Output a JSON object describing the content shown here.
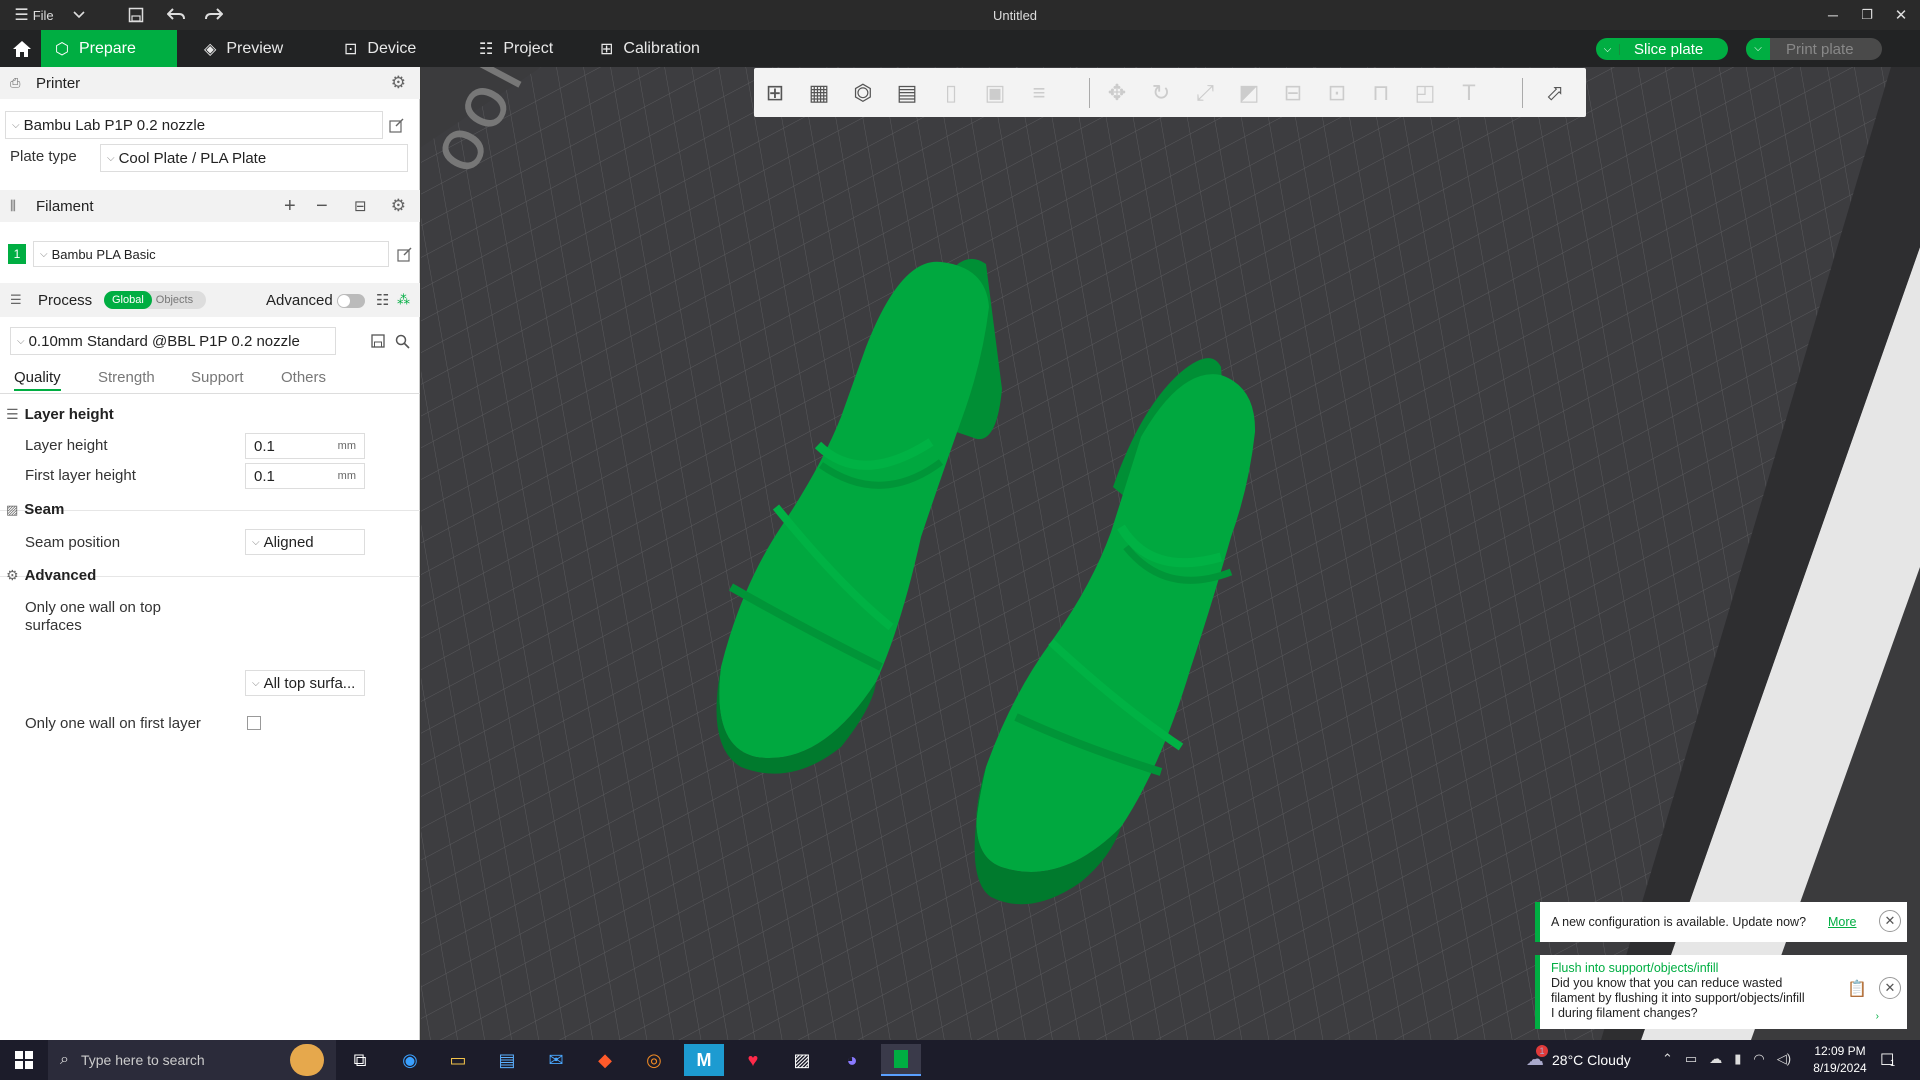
{
  "window": {
    "title": "Untitled",
    "file_menu": "File"
  },
  "nav": {
    "tabs": [
      {
        "label": "Prepare",
        "active": true
      },
      {
        "label": "Preview"
      },
      {
        "label": "Device"
      },
      {
        "label": "Project"
      },
      {
        "label": "Calibration"
      }
    ],
    "slice_button": "Slice plate",
    "print_button": "Print plate"
  },
  "printer": {
    "section_title": "Printer",
    "selected": "Bambu Lab P1P 0.2 nozzle",
    "plate_type_label": "Plate type",
    "plate_type": "Cool Plate / PLA Plate"
  },
  "filament": {
    "section_title": "Filament",
    "slots": [
      {
        "index": "1",
        "name": "Bambu PLA Basic",
        "color": "#00ae42"
      }
    ]
  },
  "process": {
    "section_title": "Process",
    "toggle_global": "Global",
    "toggle_objects": "Objects",
    "advanced_label": "Advanced",
    "preset": "0.10mm Standard @BBL P1P 0.2 nozzle",
    "tabs": [
      "Quality",
      "Strength",
      "Support",
      "Others"
    ],
    "active_tab": "Quality"
  },
  "settings": {
    "layer_height_group": "Layer height",
    "layer_height_label": "Layer height",
    "layer_height_value": "0.1",
    "first_layer_height_label": "First layer height",
    "first_layer_height_value": "0.1",
    "unit_mm": "mm",
    "seam_group": "Seam",
    "seam_position_label": "Seam position",
    "seam_position_value": "Aligned",
    "advanced_group": "Advanced",
    "one_wall_top_label_1": "Only one wall on top",
    "one_wall_top_label_2": "surfaces",
    "one_wall_top_value": "All top surfa...",
    "one_wall_first_label": "Only one wall on first layer"
  },
  "viewport": {
    "plate_label": "ool Pl",
    "model_color": "#00a83f"
  },
  "notifications": {
    "config_text": "A new configuration is available. Update now?",
    "config_link": "More",
    "tip_title": "Flush into support/objects/infill",
    "tip_line1": "Did you know that you can reduce wasted",
    "tip_line2": "filament by flushing it into support/objects/infill",
    "tip_line3": "I during filament changes?"
  },
  "taskbar": {
    "search_placeholder": "Type here to search",
    "weather": "28°C  Cloudy",
    "time": "12:09 PM",
    "date": "8/19/2024",
    "weather_badge": "1",
    "notif_count": "1"
  },
  "colors": {
    "accent": "#00ae42",
    "navbar": "#222324",
    "viewport_bg": "#3b3b3d"
  }
}
